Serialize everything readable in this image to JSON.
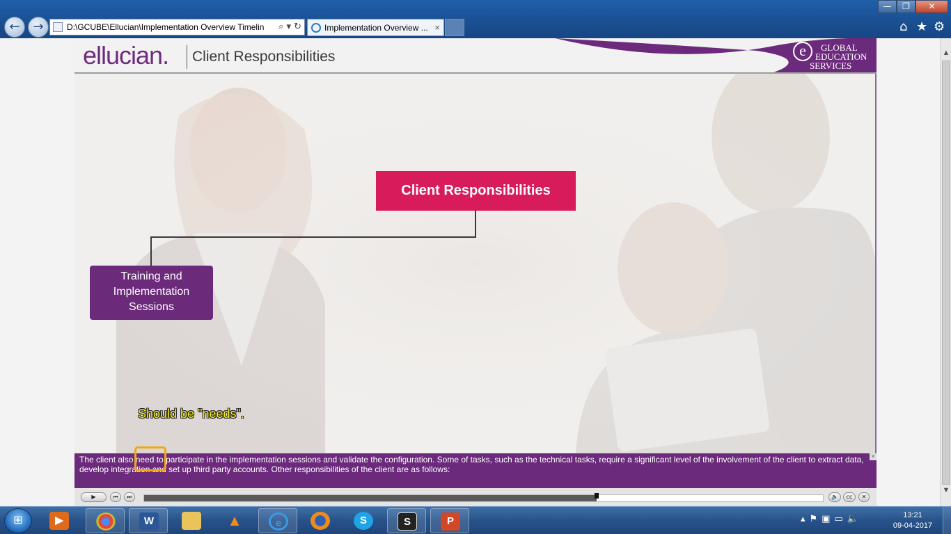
{
  "browser": {
    "address_url": "D:\\GCUBE\\Ellucian\\Implementation Overview Timelin",
    "tab_title": "Implementation Overview ...",
    "tab_close": "×",
    "window_controls": {
      "minimize": "—",
      "maximize": "❐",
      "close": "✕"
    },
    "icons": {
      "back": "back-arrow-icon",
      "forward": "forward-arrow-icon",
      "home": "home-icon",
      "favorites": "star-icon",
      "tools": "gear-icon"
    }
  },
  "slide": {
    "brand": "ellucian",
    "brand_dot": ".",
    "title": "Client Responsibilities",
    "logo": {
      "letter": "e",
      "line1": "GLOBAL",
      "line2": "EDUCATION",
      "line3": "SERVICES"
    },
    "nodes": {
      "client": "Client Responsibilities",
      "training_line1": "Training and",
      "training_line2": "Implementation",
      "training_line3": "Sessions"
    },
    "annotation": "Should be \"needs\".",
    "caption": "The client also need to participate in the implementation sessions and validate the configuration. Some of tasks, such as the technical tasks, require a significant level of the involvement of the client to extract data, develop integration and set up third party accounts. Other responsibilities of the client are as follows:",
    "caption_close": "×",
    "colors": {
      "purple": "#6c2a7c",
      "magenta": "#d81b5a",
      "highlight": "#f0a818",
      "annotation": "#f6f01c"
    }
  },
  "player": {
    "progress": 0.667,
    "buttons": {
      "play": "▶",
      "prev": "⏮",
      "next": "⏭",
      "volume": "🔈",
      "cc": "cc",
      "close": "✕"
    }
  },
  "taskbar": {
    "apps": [
      "media-player",
      "chrome",
      "word",
      "file-explorer",
      "vlc",
      "internet-explorer",
      "firefox",
      "skype",
      "scrivener",
      "powerpoint"
    ],
    "app_letters": {
      "word": "W",
      "skype": "S",
      "scrivener": "S",
      "powerpoint": "P"
    },
    "time": "13:21",
    "date": "09-04-2017"
  }
}
